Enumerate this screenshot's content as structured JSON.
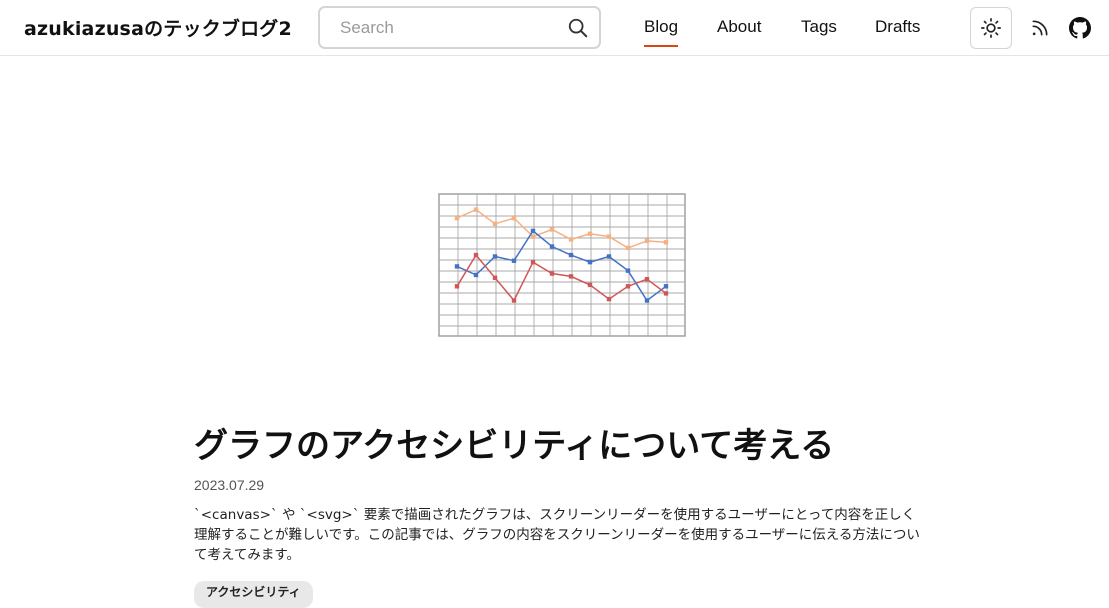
{
  "header": {
    "site_title": "azukiazusaのテックブログ2",
    "search": {
      "placeholder": "Search",
      "value": ""
    },
    "nav": [
      {
        "label": "Blog",
        "active": true
      },
      {
        "label": "About",
        "active": false
      },
      {
        "label": "Tags",
        "active": false
      },
      {
        "label": "Drafts",
        "active": false
      }
    ],
    "icons": {
      "search": "search-icon",
      "theme": "sun-icon",
      "rss": "rss-icon",
      "github": "github-icon"
    },
    "accent_color": "#d9480f"
  },
  "post": {
    "title": "グラフのアクセシビリティについて考える",
    "date": "2023.07.29",
    "description": "`<canvas>` や `<svg>` 要素で描画されたグラフは、スクリーンリーダーを使用するユーザーにとって内容を正しく理解することが難しいです。この記事では、グラフの内容をスクリーンリーダーを使用するユーザーに伝える方法について考えてみます。",
    "tags": [
      "アクセシビリティ"
    ]
  },
  "chart_data": {
    "type": "line",
    "grid": true,
    "x": [
      1,
      2,
      3,
      4,
      5,
      6,
      7,
      8,
      9,
      10,
      11,
      12
    ],
    "ylim": [
      0,
      100
    ],
    "series": [
      {
        "color": "#f4b183",
        "values": [
          83,
          89,
          79,
          83,
          70,
          75,
          68,
          72,
          70,
          62,
          67,
          66
        ]
      },
      {
        "color": "#4472c4",
        "values": [
          49,
          43,
          56,
          53,
          74,
          63,
          57,
          52,
          56,
          46,
          25,
          35
        ]
      },
      {
        "color": "#d05757",
        "values": [
          35,
          57,
          41,
          25,
          52,
          44,
          42,
          36,
          26,
          35,
          40,
          30
        ]
      }
    ]
  }
}
